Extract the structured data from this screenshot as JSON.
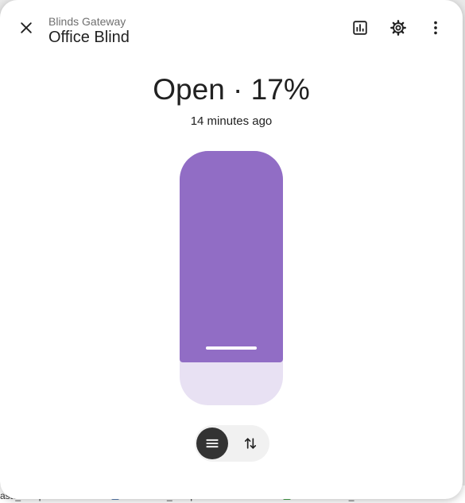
{
  "background": {
    "items": [
      "asa_Temp but...",
      "Terasa_Temp Hu...",
      "Bedroom_Switch ..."
    ]
  },
  "header": {
    "subtitle": "Blinds Gateway",
    "title": "Office Blind"
  },
  "icons": {
    "close": "close-icon",
    "history": "chart-box-icon",
    "settings": "gear-icon",
    "more": "dots-vertical-icon",
    "position_mode": "menu-lines-icon",
    "buttons_mode": "arrow-up-down-icon"
  },
  "state": {
    "label": "Open · 17%",
    "last_changed": "14 minutes ago"
  },
  "cover": {
    "position_percent": 17,
    "fill_color": "#916dc5",
    "track_color": "#e8e1f3"
  }
}
